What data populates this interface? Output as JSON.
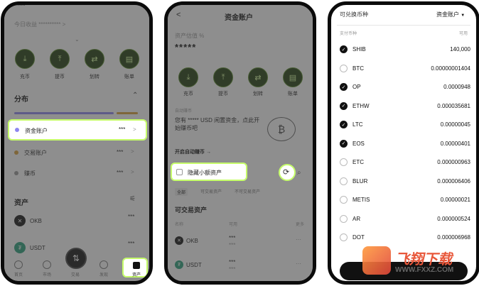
{
  "phone1": {
    "header_label": "今日收益",
    "header_value": "**********",
    "header_chevron": ">",
    "actions": [
      {
        "label": "充币",
        "icon": "download-icon"
      },
      {
        "label": "提币",
        "icon": "upload-icon"
      },
      {
        "label": "划转",
        "icon": "transfer-icon"
      },
      {
        "label": "账单",
        "icon": "bill-icon"
      }
    ],
    "section_title": "分布",
    "accounts": [
      {
        "label": "资金账户",
        "masked": "***",
        "dot_color": "#8e86f0",
        "arrow": ">"
      },
      {
        "label": "交易账户",
        "masked": "***",
        "dot_color": "#d9a037",
        "arrow": ">"
      },
      {
        "label": "赚币",
        "masked": "***",
        "dot_color": "#999999",
        "arrow": ">"
      }
    ],
    "assets_title": "资产",
    "assets": [
      {
        "symbol": "OKB",
        "masked": "***"
      },
      {
        "symbol": "USDT",
        "masked": "***"
      }
    ],
    "nav": [
      "首页",
      "市场",
      "交易",
      "发现",
      "资产"
    ]
  },
  "phone2": {
    "title": "资金账户",
    "back": "<",
    "valuation_label": "资产估值",
    "valuation_unit": "%",
    "valuation_value": "*****",
    "actions": [
      {
        "label": "充币",
        "icon": "download-icon"
      },
      {
        "label": "提币",
        "icon": "upload-icon"
      },
      {
        "label": "划转",
        "icon": "transfer-icon"
      },
      {
        "label": "账单",
        "icon": "bill-icon"
      }
    ],
    "promo_small": "自动赚币",
    "promo_text_1": "您有 ***** USD 闲置资金，点此开",
    "promo_text_2": "始赚币吧",
    "promo_link": "开启自动赚币 →",
    "hide_small_label": "隐藏小额资产",
    "filters": [
      "全部",
      "可交易资产",
      "不可交易资产"
    ],
    "tradeable_title": "可交易资产",
    "col_name": "名称",
    "col_available": "可用",
    "col_more": "更多",
    "assets": [
      {
        "symbol": "OKB",
        "masked": "***",
        "masked2": "***"
      },
      {
        "symbol": "USDT",
        "masked": "***",
        "masked2": "***"
      }
    ]
  },
  "phone3": {
    "header_left": "可兑换币种",
    "header_right": "资金账户",
    "col_left": "支付币种",
    "col_right": "可用",
    "coins": [
      {
        "symbol": "SHIB",
        "amount": "140,000",
        "checked": true
      },
      {
        "symbol": "BTC",
        "amount": "0.00000001404",
        "checked": false
      },
      {
        "symbol": "OP",
        "amount": "0.0000948",
        "checked": true
      },
      {
        "symbol": "ETHW",
        "amount": "0.000035681",
        "checked": true
      },
      {
        "symbol": "LTC",
        "amount": "0.00000045",
        "checked": true
      },
      {
        "symbol": "EOS",
        "amount": "0.00000401",
        "checked": true
      },
      {
        "symbol": "ETC",
        "amount": "0.000000963",
        "checked": false
      },
      {
        "symbol": "BLUR",
        "amount": "0.000006406",
        "checked": false
      },
      {
        "symbol": "METIS",
        "amount": "0.00000021",
        "checked": false
      },
      {
        "symbol": "AR",
        "amount": "0.000000524",
        "checked": false
      },
      {
        "symbol": "DOT",
        "amount": "0.000006968",
        "checked": false
      }
    ]
  },
  "watermark": {
    "text_cn": "飞翔下载",
    "text_url": "WWW.FXXZ.COM"
  }
}
